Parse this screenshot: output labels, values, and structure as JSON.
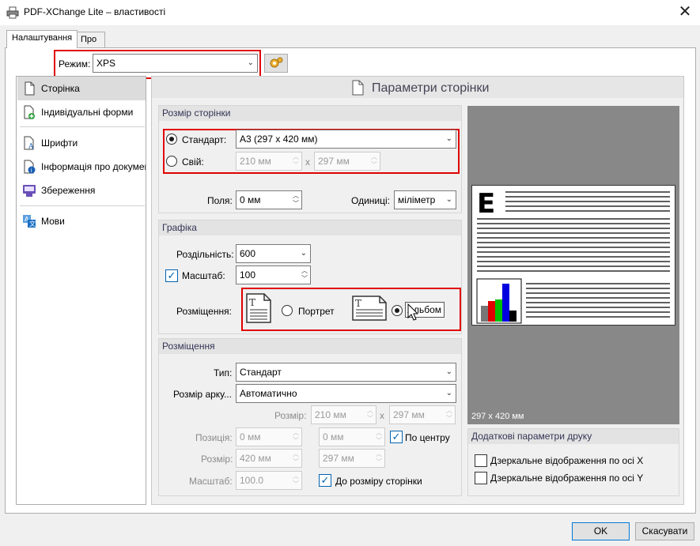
{
  "window": {
    "title": "PDF-XChange Lite – властивості",
    "close": "✕"
  },
  "tabs": [
    {
      "label": "Налаштування"
    },
    {
      "label": "Про"
    }
  ],
  "mode": {
    "label": "Режим:",
    "value": "XPS"
  },
  "sidebar": {
    "items": [
      {
        "label": "Сторінка"
      },
      {
        "label": "Індивідуальні форми"
      },
      {
        "label": "Шрифти"
      },
      {
        "label": "Інформація про документ"
      },
      {
        "label": "Збереження"
      },
      {
        "label": "Мови"
      }
    ]
  },
  "page": {
    "title": "Параметри сторінки"
  },
  "page_size": {
    "header": "Розмір сторінки",
    "standard_label": "Стандарт:",
    "standard_value": "A3 (297 x 420 мм)",
    "custom_label": "Свій:",
    "width": "210 мм",
    "x": "x",
    "height": "297 мм",
    "margins_label": "Поля:",
    "margins_value": "0 мм",
    "units_label": "Одиниці:",
    "units_value": "міліметр"
  },
  "graphics": {
    "header": "Графіка",
    "resolution_label": "Роздільність:",
    "resolution_value": "600",
    "scale_label": "Масштаб:",
    "scale_value": "100",
    "placement_label": "Розміщення:",
    "portrait": "Портрет",
    "landscape": "Альбом"
  },
  "placement": {
    "header": "Розміщення",
    "type_label": "Тип:",
    "type_value": "Стандарт",
    "sheet_label": "Розмір арку...",
    "sheet_value": "Автоматично",
    "size_label": "Розмір:",
    "size_w": "210 мм",
    "x": "x",
    "size_h": "297 мм",
    "pos_label": "Позиція:",
    "pos_x": "0 мм",
    "pos_y": "0 мм",
    "center": "По центру",
    "dim_label": "Розмір:",
    "dim_w": "420 мм",
    "dim_h": "297 мм",
    "scale_label": "Масштаб:",
    "scale_value": "100.0",
    "fit": "До розміру сторінки"
  },
  "preview": {
    "size": "297 x 420 мм"
  },
  "extra": {
    "header": "Додаткові параметри друку",
    "mirror_x": "Дзеркальне відображення по осі X",
    "mirror_y": "Дзеркальне відображення по осі Y"
  },
  "buttons": {
    "ok": "OK",
    "cancel": "Скасувати"
  }
}
